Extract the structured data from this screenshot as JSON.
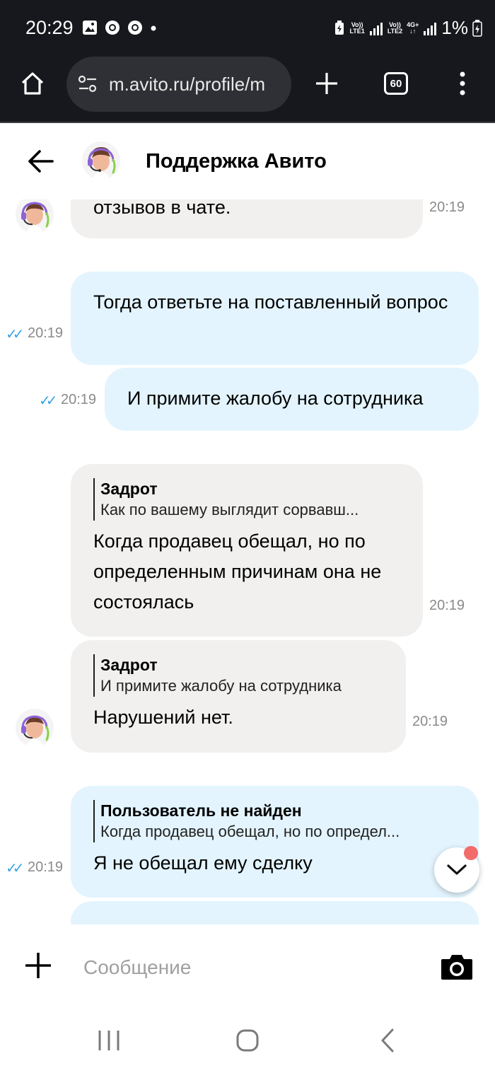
{
  "status_bar": {
    "time": "20:29",
    "net1_top": "Vo))",
    "net1_bottom": "LTE1",
    "net2_top": "Vo))",
    "net2_bottom": "LTE2",
    "net2_type": "4G+",
    "battery": "1%"
  },
  "browser": {
    "url": "m.avito.ru/profile/m",
    "tab_count": "60"
  },
  "chat_header": {
    "title": "Поддержка Авито"
  },
  "messages": [
    {
      "direction": "incoming",
      "text": "отзывов в чате.",
      "time": "20:19"
    },
    {
      "direction": "outgoing",
      "text": "Тогда ответьте на поставленный вопрос",
      "time": "20:19",
      "read": true
    },
    {
      "direction": "outgoing",
      "text": "И примите жалобу на сотрудника",
      "time": "20:19",
      "read": true
    },
    {
      "direction": "incoming",
      "quote_author": "Задрот",
      "quote_text": "Как по вашему выглядит сорвавш...",
      "text": "Когда продавец обещал,  но по определенным причинам она не состоялась",
      "time": "20:19"
    },
    {
      "direction": "incoming",
      "quote_author": "Задрот",
      "quote_text": "И примите жалобу на сотрудника",
      "text": "Нарушений нет.",
      "time": "20:19"
    },
    {
      "direction": "outgoing",
      "quote_author": "Пользователь не найден",
      "quote_text": "Когда продавец обещал, но по определ...",
      "text": "Я не обещал ему сделку",
      "time": "20:19",
      "read": true
    }
  ],
  "composer": {
    "placeholder": "Сообщение"
  },
  "colors": {
    "incoming_bubble": "#f1f0ef",
    "outgoing_bubble": "#e3f4fe",
    "read_check": "#3aa4e8",
    "unread_dot": "#f26c6c",
    "system_bar": "#16181d"
  }
}
